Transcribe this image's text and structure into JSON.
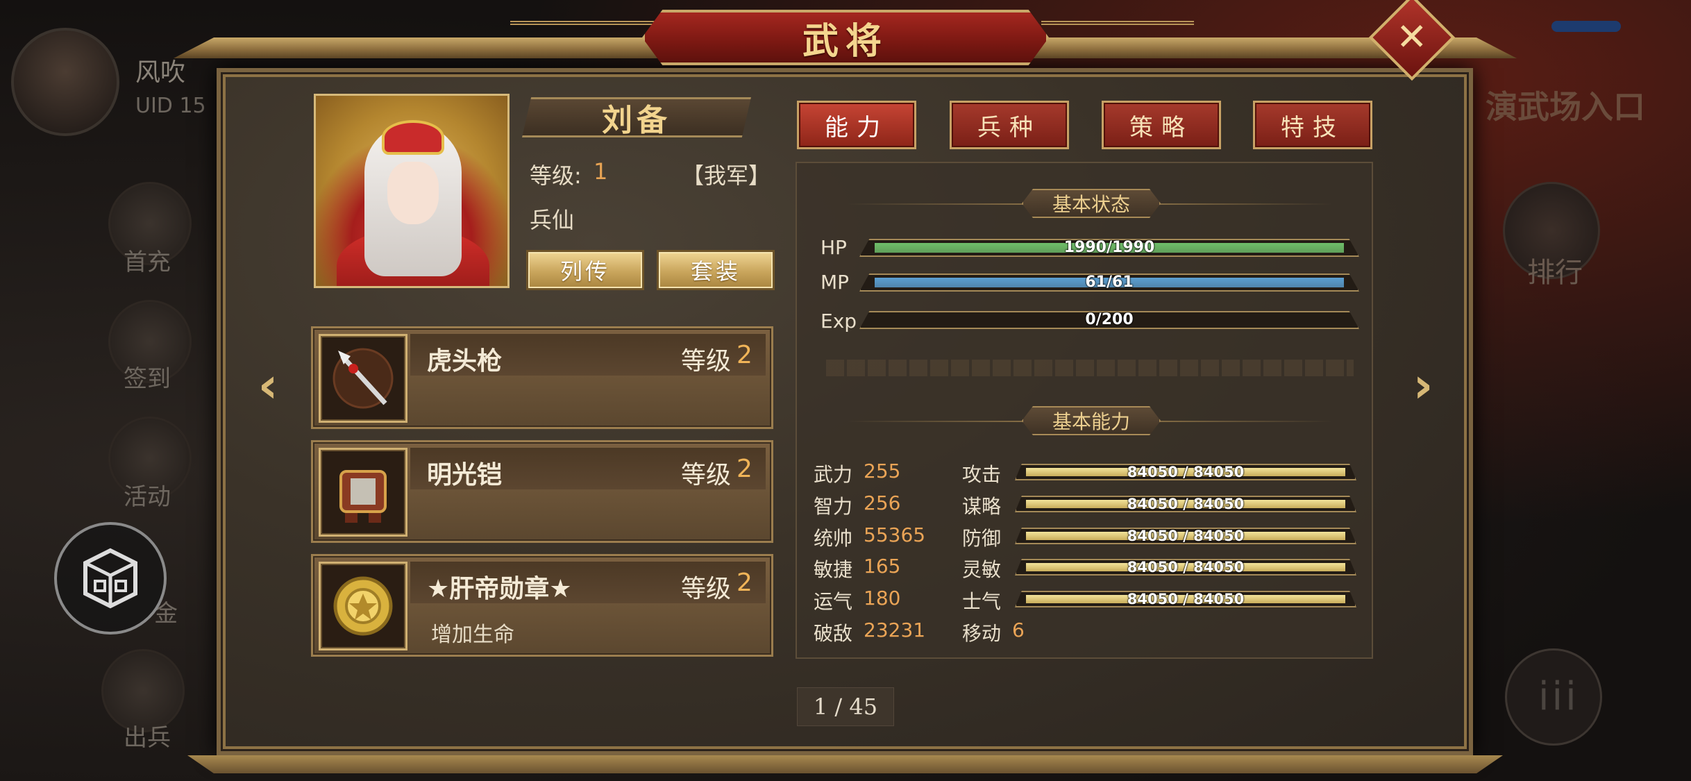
{
  "background": {
    "player_name": "风吹",
    "player_uid": "UID  15",
    "side_buttons": [
      "首充",
      "签到",
      "活动",
      "金",
      "出兵"
    ],
    "right_title": "演武场入口",
    "rank_label": "排行",
    "menu_glyph": "iii"
  },
  "window": {
    "title": "武将",
    "close_glyph": "✕"
  },
  "hero": {
    "name": "刘备",
    "level_label": "等级:",
    "level_value": "1",
    "faction": "【我军】",
    "class": "兵仙",
    "biography_button": "列传",
    "set_button": "套装"
  },
  "equipment": [
    {
      "name": "虎头枪",
      "level_label": "等级",
      "level": "2",
      "desc": "",
      "icon": "spear-icon"
    },
    {
      "name": "明光铠",
      "level_label": "等级",
      "level": "2",
      "desc": "",
      "icon": "armor-icon"
    },
    {
      "name": "★肝帝勋章★",
      "level_label": "等级",
      "level": "2",
      "desc": "增加生命",
      "icon": "medal-icon"
    }
  ],
  "tabs": [
    "能力",
    "兵种",
    "策略",
    "特技"
  ],
  "active_tab": 0,
  "basic_status": {
    "title": "基本状态",
    "bars": [
      {
        "label": "HP",
        "text": "1990/1990",
        "fill": 1.0,
        "color": "#6fbf6a"
      },
      {
        "label": "MP",
        "text": "61/61",
        "fill": 1.0,
        "color": "#5b9fd1"
      },
      {
        "label": "Exp",
        "text": "0/200",
        "fill": 0.0,
        "color": "#d0b46a"
      }
    ]
  },
  "basic_ability": {
    "title": "基本能力",
    "left": [
      {
        "name": "武力",
        "value": "255"
      },
      {
        "name": "智力",
        "value": "256"
      },
      {
        "name": "统帅",
        "value": "55365"
      },
      {
        "name": "敏捷",
        "value": "165"
      },
      {
        "name": "运气",
        "value": "180"
      },
      {
        "name": "破敌",
        "value": "23231"
      }
    ],
    "right": [
      {
        "name": "攻击",
        "text": "84050 / 84050",
        "fill": 1.0
      },
      {
        "name": "谋略",
        "text": "84050 / 84050",
        "fill": 1.0
      },
      {
        "name": "防御",
        "text": "84050 / 84050",
        "fill": 1.0
      },
      {
        "name": "灵敏",
        "text": "84050 / 84050",
        "fill": 1.0
      },
      {
        "name": "士气",
        "text": "84050 / 84050",
        "fill": 1.0
      }
    ],
    "move_label": "移动",
    "move_value": "6"
  },
  "pager": "1 / 45",
  "nav": {
    "prev": "‹",
    "next": "›"
  }
}
